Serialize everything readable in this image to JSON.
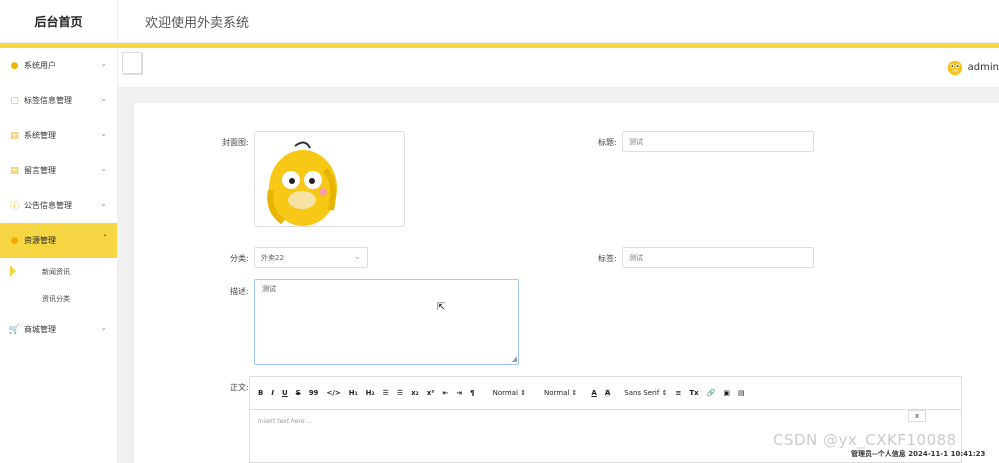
{
  "header": {
    "brand": "后台首页",
    "welcome": "欢迎使用外卖系统"
  },
  "sidebar": {
    "items": [
      {
        "label": "系统用户",
        "icon": "user-icon"
      },
      {
        "label": "标签信息管理",
        "icon": "tag-icon"
      },
      {
        "label": "系统管理",
        "icon": "settings-icon"
      },
      {
        "label": "留言管理",
        "icon": "message-icon"
      },
      {
        "label": "公告信息管理",
        "icon": "notice-icon"
      },
      {
        "label": "资源管理",
        "icon": "resource-icon"
      },
      {
        "label": "商城管理",
        "icon": "cart-icon"
      }
    ],
    "subitems": [
      {
        "label": "新闻资讯"
      },
      {
        "label": "资讯分类"
      }
    ]
  },
  "topbar": {
    "username": "admin"
  },
  "form": {
    "cover_label": "封面图:",
    "title_label": "标题:",
    "title_value": "测试",
    "category_label": "分类:",
    "category_value": "外卖22",
    "tags_label": "标签:",
    "tags_value": "测试",
    "desc_label": "描述:",
    "desc_value": "测试",
    "content_label": "正文:"
  },
  "editor": {
    "toolbar": [
      "B",
      "I",
      "U",
      "S",
      "99",
      "</>",
      "H₁",
      "H₂",
      "☰",
      "☰",
      "x₂",
      "x²",
      "⇤",
      "⇥",
      "¶",
      "Normal ⇕",
      "Normal ⇕",
      "A",
      "A",
      "Sans Serif ⇕",
      "≡",
      "Tx",
      "🔗",
      "▣",
      "▤"
    ],
    "placeholder": "Insert text here ...",
    "close": "x"
  },
  "watermark": "CSDN @yx_CXKF10088",
  "footer": "管理员--个人信息 2024-11-1 10:41:23",
  "colors": {
    "accent": "#f6d743"
  }
}
